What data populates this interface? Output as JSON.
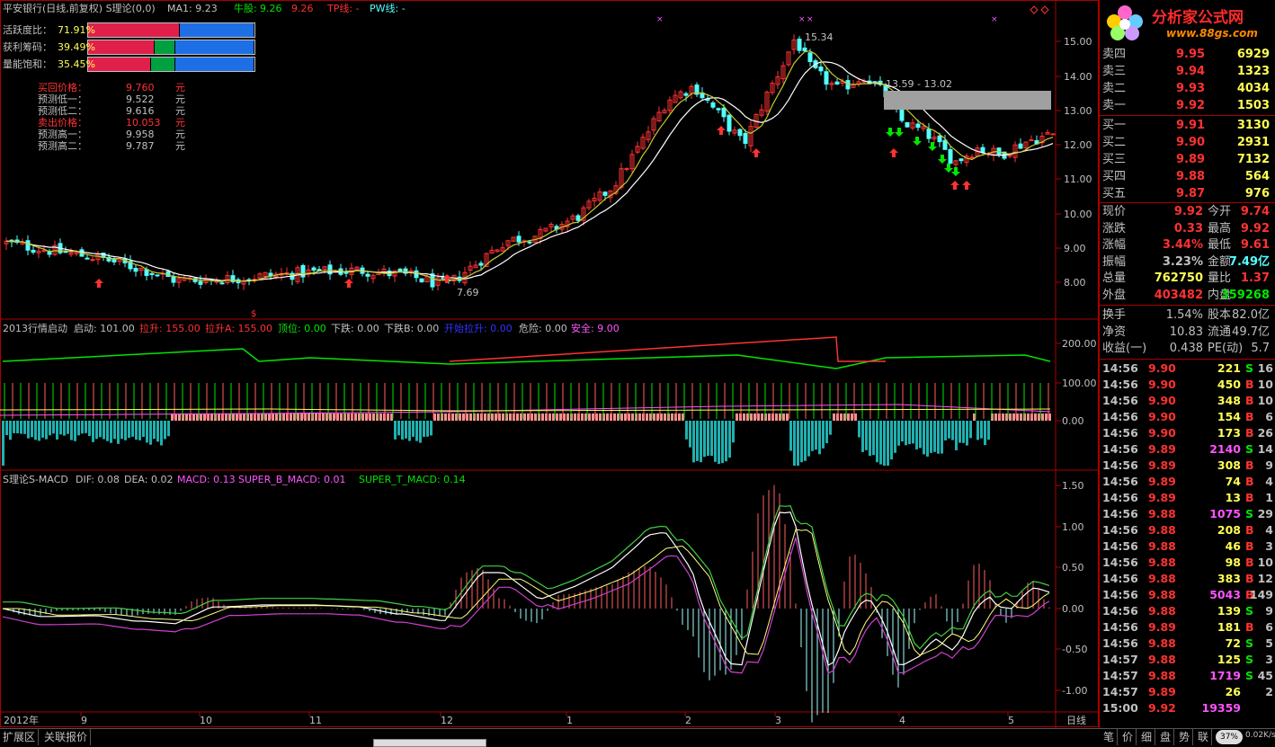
{
  "header": {
    "title": "平安银行(日线,前复权) S理论(0,0)",
    "ma": "MA1: 9.23",
    "niu_label": "牛股:",
    "niu_v1": "9.26",
    "niu_v2": "9.26",
    "tp": "TP线: -",
    "pw": "PW线: -"
  },
  "gauges": [
    {
      "label": "活跃度比：",
      "value": "71.91%"
    },
    {
      "label": "获利筹码：",
      "value": "39.49%"
    },
    {
      "label": "量能饱和：",
      "value": "35.45%"
    }
  ],
  "prices": [
    {
      "label": "买回价格：",
      "value": "9.760",
      "unit": "元"
    },
    {
      "label": "预测低一：",
      "value": "9.522",
      "unit": "元"
    },
    {
      "label": "预测低二：",
      "value": "9.616",
      "unit": "元"
    },
    {
      "label": "卖出价格：",
      "value": "10.053",
      "unit": "元"
    },
    {
      "label": "预测高一：",
      "value": "9.958",
      "unit": "元"
    },
    {
      "label": "预测高二：",
      "value": "9.787",
      "unit": "元"
    }
  ],
  "main_axis": [
    "15.00",
    "14.00",
    "13.00",
    "12.00",
    "11.00",
    "10.00",
    "9.00",
    "8.00"
  ],
  "annotations": {
    "high": "15.34",
    "low": "7.69",
    "range": "13.59 - 13.02",
    "buy": "买",
    "dollar": "$"
  },
  "ind1": {
    "title": "2013行情启动",
    "qidong": "启动: 101.00",
    "lasheng": "拉升: 155.00",
    "lashengA": "拉升A: 155.00",
    "dingwei": "顶位: 0.00",
    "xiadie": "下跌: 0.00",
    "xiadieB": "下跌B: 0.00",
    "kaishi": "开始拉升: 0.00",
    "weixian": "危险: 0.00",
    "anquan": "安全: 9.00",
    "axis": [
      "200.00",
      "100.00",
      "0.00"
    ]
  },
  "ind2": {
    "title": "S理论S-MACD",
    "dif": "DIF: 0.08",
    "dea": "DEA: 0.02",
    "macd": "MACD: 0.13",
    "sbm": "SUPER_B_MACD: 0.01",
    "stm": "SUPER_T_MACD: 0.14",
    "axis": [
      "1.50",
      "1.00",
      "0.50",
      "0.00",
      "-0.50",
      "-1.00"
    ]
  },
  "time_axis": [
    "2012年",
    "9",
    "10",
    "11",
    "12",
    "1",
    "2",
    "3",
    "4",
    "5"
  ],
  "time_axis_label": "日线",
  "logo": {
    "text": "分析家公式网",
    "url": "www.88gs.com"
  },
  "order_book": {
    "asks": [
      {
        "label": "卖四",
        "price": "9.95",
        "vol": "6929"
      },
      {
        "label": "卖三",
        "price": "9.94",
        "vol": "1323"
      },
      {
        "label": "卖二",
        "price": "9.93",
        "vol": "4034"
      },
      {
        "label": "卖一",
        "price": "9.92",
        "vol": "1503"
      }
    ],
    "bids": [
      {
        "label": "买一",
        "price": "9.91",
        "vol": "3130"
      },
      {
        "label": "买二",
        "price": "9.90",
        "vol": "2931"
      },
      {
        "label": "买三",
        "price": "9.89",
        "vol": "7132"
      },
      {
        "label": "买四",
        "price": "9.88",
        "vol": "564"
      },
      {
        "label": "买五",
        "price": "9.87",
        "vol": "976"
      }
    ]
  },
  "stats": [
    {
      "l1": "现价",
      "v1": "9.92",
      "l2": "今开",
      "v2": "9.74"
    },
    {
      "l1": "涨跌",
      "v1": "0.33",
      "l2": "最高",
      "v2": "9.92"
    },
    {
      "l1": "涨幅",
      "v1": "3.44%",
      "l2": "最低",
      "v2": "9.61"
    },
    {
      "l1": "振幅",
      "v1": "3.23%",
      "l2": "金额",
      "v2": "7.49亿"
    },
    {
      "l1": "总量",
      "v1": "762750",
      "l2": "量比",
      "v2": "1.37"
    },
    {
      "l1": "外盘",
      "v1": "403482",
      "l2": "内盘",
      "v2": "359268"
    }
  ],
  "stats2": [
    {
      "l1": "换手",
      "v1": "1.54%",
      "l2": "股本",
      "v2": "82.0亿"
    },
    {
      "l1": "净资",
      "v1": "10.83",
      "l2": "流通",
      "v2": "49.7亿"
    },
    {
      "l1": "收益(一)",
      "v1": "0.438",
      "l2": "PE(动)",
      "v2": "5.7"
    }
  ],
  "ticks": [
    {
      "time": "14:56",
      "price": "9.90",
      "vol": "221",
      "side": "S",
      "n": "16"
    },
    {
      "time": "14:56",
      "price": "9.90",
      "vol": "450",
      "side": "B",
      "n": "10"
    },
    {
      "time": "14:56",
      "price": "9.90",
      "vol": "348",
      "side": "B",
      "n": "10"
    },
    {
      "time": "14:56",
      "price": "9.90",
      "vol": "154",
      "side": "B",
      "n": "6"
    },
    {
      "time": "14:56",
      "price": "9.90",
      "vol": "173",
      "side": "B",
      "n": "26"
    },
    {
      "time": "14:56",
      "price": "9.89",
      "vol": "2140",
      "side": "S",
      "n": "14"
    },
    {
      "time": "14:56",
      "price": "9.89",
      "vol": "308",
      "side": "B",
      "n": "9"
    },
    {
      "time": "14:56",
      "price": "9.89",
      "vol": "74",
      "side": "B",
      "n": "4"
    },
    {
      "time": "14:56",
      "price": "9.89",
      "vol": "13",
      "side": "B",
      "n": "1"
    },
    {
      "time": "14:56",
      "price": "9.88",
      "vol": "1075",
      "side": "S",
      "n": "29"
    },
    {
      "time": "14:56",
      "price": "9.88",
      "vol": "208",
      "side": "B",
      "n": "4"
    },
    {
      "time": "14:56",
      "price": "9.88",
      "vol": "46",
      "side": "B",
      "n": "3"
    },
    {
      "time": "14:56",
      "price": "9.88",
      "vol": "98",
      "side": "B",
      "n": "10"
    },
    {
      "time": "14:56",
      "price": "9.88",
      "vol": "383",
      "side": "B",
      "n": "12"
    },
    {
      "time": "14:56",
      "price": "9.88",
      "vol": "5043",
      "side": "B",
      "n": "149"
    },
    {
      "time": "14:56",
      "price": "9.88",
      "vol": "139",
      "side": "S",
      "n": "9"
    },
    {
      "time": "14:56",
      "price": "9.89",
      "vol": "181",
      "side": "B",
      "n": "6"
    },
    {
      "time": "14:56",
      "price": "9.88",
      "vol": "72",
      "side": "S",
      "n": "5"
    },
    {
      "time": "14:57",
      "price": "9.88",
      "vol": "125",
      "side": "S",
      "n": "3"
    },
    {
      "time": "14:57",
      "price": "9.88",
      "vol": "1719",
      "side": "S",
      "n": "45"
    },
    {
      "time": "14:57",
      "price": "9.89",
      "vol": "26",
      "side": "",
      "n": "2"
    },
    {
      "time": "15:00",
      "price": "9.92",
      "vol": "19359",
      "side": "",
      "n": ""
    }
  ],
  "bottom_tabs": [
    "扩展区",
    "关联报价"
  ],
  "right_tabs": [
    "笔",
    "价",
    "细",
    "盘",
    "势",
    "联"
  ],
  "zoom": "37%",
  "speed": "0.02K/s",
  "colors": {
    "up": "#ff3232",
    "down": "#54ffff",
    "frame": "#aa0000",
    "text": "#c0c0c0",
    "yellow": "#ffff54",
    "green": "#00e600",
    "magenta": "#ff54ff"
  }
}
